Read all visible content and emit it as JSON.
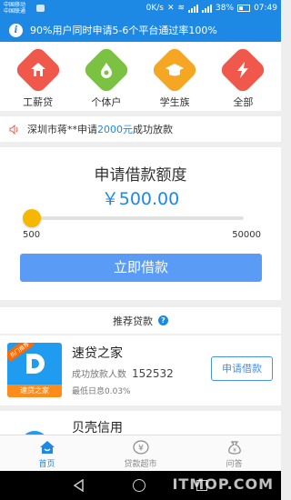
{
  "status_bar": {
    "carrier_1": "中国移动",
    "carrier_2": "中国联通",
    "speed": "0K/s",
    "battery": "38%",
    "time": "07:49"
  },
  "notice": {
    "text": "90%用户同时申请5-6个平台通过率100%"
  },
  "categories": [
    {
      "label": "工薪贷",
      "color": "#f0584c",
      "icon": "house-icon"
    },
    {
      "label": "个体户",
      "color": "#7cc242",
      "icon": "drop-icon"
    },
    {
      "label": "学生族",
      "color": "#f5a623",
      "icon": "graduation-cap-icon"
    },
    {
      "label": "全部",
      "color": "#f0584c",
      "icon": "lightning-icon"
    }
  ],
  "ticker": {
    "prefix": "深圳市蒋**申请",
    "amount": "2000元",
    "suffix": "成功放款"
  },
  "loan": {
    "title": "申请借款额度",
    "amount": "￥500.00",
    "min": "500",
    "max": "50000",
    "slider_fraction": 0,
    "apply_label": "立即借款"
  },
  "recommend": {
    "title": "推荐贷款",
    "help": "?"
  },
  "product": {
    "logo_ribbon": "热门推荐",
    "logo_caption": "速贷之家",
    "name": "速贷之家",
    "count_label": "成功放款人数",
    "count_value": "152532",
    "rate": "最低日息0.03%",
    "button": "申请借款"
  },
  "product2": {
    "name": "贝壳信用"
  },
  "tabbar": [
    {
      "label": "首页",
      "active": true
    },
    {
      "label": "贷款超市",
      "active": false
    },
    {
      "label": "问答",
      "active": false
    }
  ],
  "watermark": "ITMOP.COM",
  "colors": {
    "primary": "#1e88e5",
    "button": "#5a9cf5",
    "thumb": "#f5b800"
  }
}
